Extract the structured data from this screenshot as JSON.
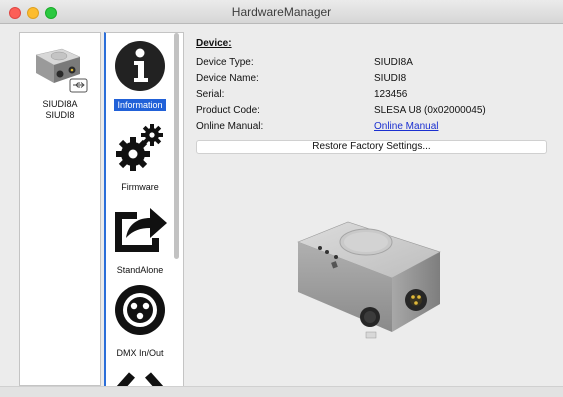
{
  "window": {
    "title": "HardwareManager"
  },
  "device_list": {
    "items": [
      {
        "name": "SIUDI8A",
        "subname": "SIUDI8"
      }
    ]
  },
  "nav": {
    "items": [
      {
        "label": "Information",
        "icon": "info-icon",
        "selected": true
      },
      {
        "label": "Firmware",
        "icon": "gears-icon",
        "selected": false
      },
      {
        "label": "StandAlone",
        "icon": "export-arrow-icon",
        "selected": false
      },
      {
        "label": "DMX In/Out",
        "icon": "xlr-connector-icon",
        "selected": false
      },
      {
        "label": "",
        "icon": "code-brackets-icon",
        "selected": false
      }
    ]
  },
  "info": {
    "heading": "Device:",
    "rows": [
      {
        "key": "Device Type:",
        "value": "SIUDI8A"
      },
      {
        "key": "Device Name:",
        "value": "SIUDI8"
      },
      {
        "key": "Serial:",
        "value": "123456"
      },
      {
        "key": "Product Code:",
        "value": "SLESA U8 (0x02000045)"
      },
      {
        "key": "Online Manual:",
        "value": "Online Manual",
        "link": true
      }
    ],
    "restore_button": "Restore Factory Settings..."
  },
  "colors": {
    "selection": "#2161d8",
    "link": "#1a2fd0"
  }
}
